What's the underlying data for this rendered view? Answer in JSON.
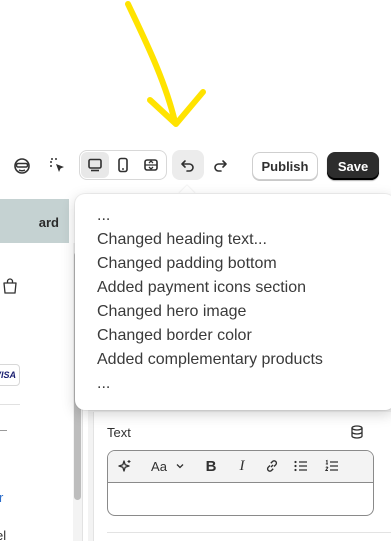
{
  "toolbar": {
    "publish_label": "Publish",
    "save_label": "Save",
    "icons": [
      "inspector-icon",
      "select-element-icon",
      "desktop-view-icon",
      "mobile-view-icon",
      "fullscreen-view-icon",
      "undo-icon",
      "redo-icon"
    ]
  },
  "history": {
    "items": [
      "...",
      "Changed heading text...",
      "Changed padding bottom",
      "Added payment icons section",
      "Changed hero image",
      "Changed border color",
      "Added complementary products",
      "..."
    ]
  },
  "sidebar": {
    "top_item_label": "ard",
    "visa_label": "VISA",
    "text_r": "r",
    "text_el": "el"
  },
  "panel": {
    "text_label": "Text",
    "format_label": "Aa"
  },
  "colors": {
    "annotation_arrow": "#ffe300",
    "save_bg": "#2d2d2d",
    "sidebar_selected": "#c5d2d2",
    "link_blue": "#2c6ecb"
  }
}
